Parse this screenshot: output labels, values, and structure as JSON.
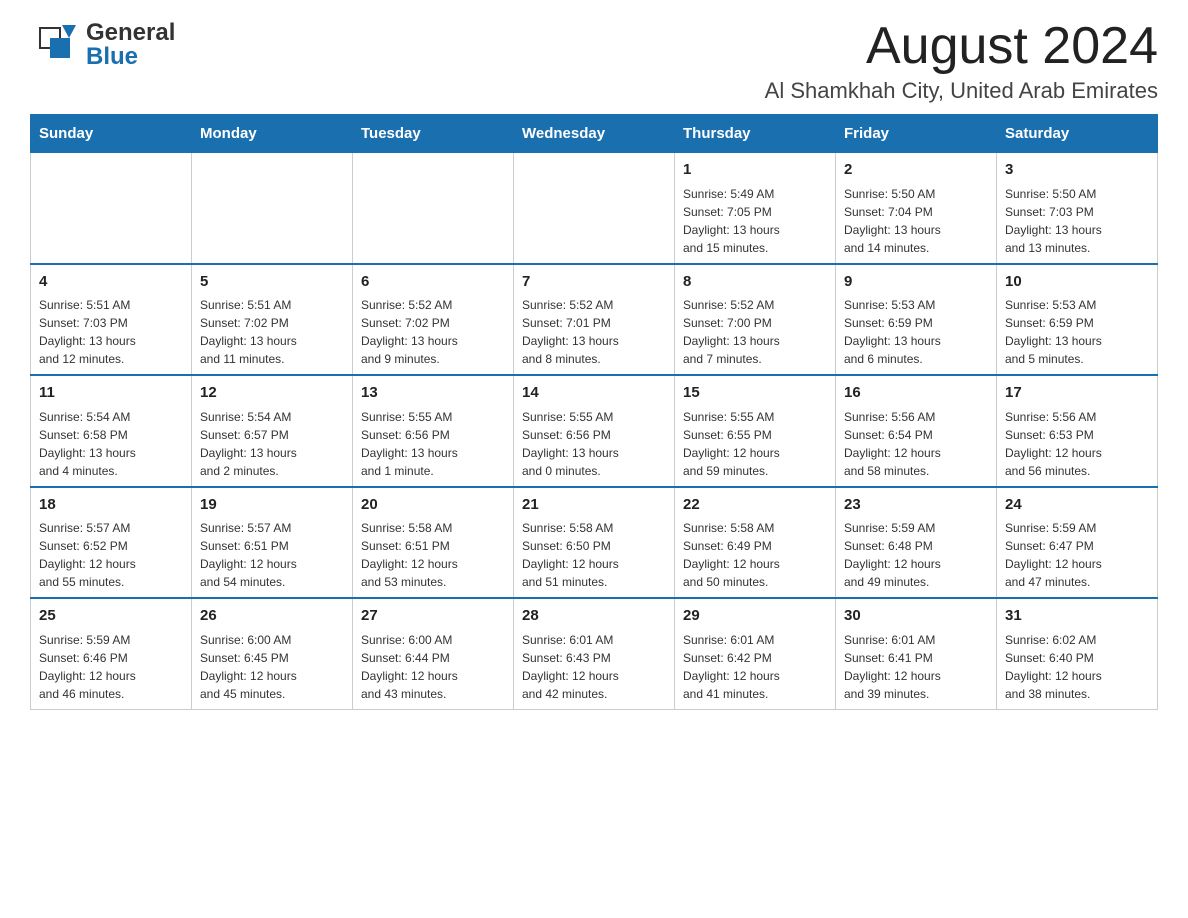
{
  "logo": {
    "general": "General",
    "blue": "Blue"
  },
  "title": "August 2024",
  "subtitle": "Al Shamkhah City, United Arab Emirates",
  "days_of_week": [
    "Sunday",
    "Monday",
    "Tuesday",
    "Wednesday",
    "Thursday",
    "Friday",
    "Saturday"
  ],
  "weeks": [
    [
      {
        "day": "",
        "info": ""
      },
      {
        "day": "",
        "info": ""
      },
      {
        "day": "",
        "info": ""
      },
      {
        "day": "",
        "info": ""
      },
      {
        "day": "1",
        "info": "Sunrise: 5:49 AM\nSunset: 7:05 PM\nDaylight: 13 hours\nand 15 minutes."
      },
      {
        "day": "2",
        "info": "Sunrise: 5:50 AM\nSunset: 7:04 PM\nDaylight: 13 hours\nand 14 minutes."
      },
      {
        "day": "3",
        "info": "Sunrise: 5:50 AM\nSunset: 7:03 PM\nDaylight: 13 hours\nand 13 minutes."
      }
    ],
    [
      {
        "day": "4",
        "info": "Sunrise: 5:51 AM\nSunset: 7:03 PM\nDaylight: 13 hours\nand 12 minutes."
      },
      {
        "day": "5",
        "info": "Sunrise: 5:51 AM\nSunset: 7:02 PM\nDaylight: 13 hours\nand 11 minutes."
      },
      {
        "day": "6",
        "info": "Sunrise: 5:52 AM\nSunset: 7:02 PM\nDaylight: 13 hours\nand 9 minutes."
      },
      {
        "day": "7",
        "info": "Sunrise: 5:52 AM\nSunset: 7:01 PM\nDaylight: 13 hours\nand 8 minutes."
      },
      {
        "day": "8",
        "info": "Sunrise: 5:52 AM\nSunset: 7:00 PM\nDaylight: 13 hours\nand 7 minutes."
      },
      {
        "day": "9",
        "info": "Sunrise: 5:53 AM\nSunset: 6:59 PM\nDaylight: 13 hours\nand 6 minutes."
      },
      {
        "day": "10",
        "info": "Sunrise: 5:53 AM\nSunset: 6:59 PM\nDaylight: 13 hours\nand 5 minutes."
      }
    ],
    [
      {
        "day": "11",
        "info": "Sunrise: 5:54 AM\nSunset: 6:58 PM\nDaylight: 13 hours\nand 4 minutes."
      },
      {
        "day": "12",
        "info": "Sunrise: 5:54 AM\nSunset: 6:57 PM\nDaylight: 13 hours\nand 2 minutes."
      },
      {
        "day": "13",
        "info": "Sunrise: 5:55 AM\nSunset: 6:56 PM\nDaylight: 13 hours\nand 1 minute."
      },
      {
        "day": "14",
        "info": "Sunrise: 5:55 AM\nSunset: 6:56 PM\nDaylight: 13 hours\nand 0 minutes."
      },
      {
        "day": "15",
        "info": "Sunrise: 5:55 AM\nSunset: 6:55 PM\nDaylight: 12 hours\nand 59 minutes."
      },
      {
        "day": "16",
        "info": "Sunrise: 5:56 AM\nSunset: 6:54 PM\nDaylight: 12 hours\nand 58 minutes."
      },
      {
        "day": "17",
        "info": "Sunrise: 5:56 AM\nSunset: 6:53 PM\nDaylight: 12 hours\nand 56 minutes."
      }
    ],
    [
      {
        "day": "18",
        "info": "Sunrise: 5:57 AM\nSunset: 6:52 PM\nDaylight: 12 hours\nand 55 minutes."
      },
      {
        "day": "19",
        "info": "Sunrise: 5:57 AM\nSunset: 6:51 PM\nDaylight: 12 hours\nand 54 minutes."
      },
      {
        "day": "20",
        "info": "Sunrise: 5:58 AM\nSunset: 6:51 PM\nDaylight: 12 hours\nand 53 minutes."
      },
      {
        "day": "21",
        "info": "Sunrise: 5:58 AM\nSunset: 6:50 PM\nDaylight: 12 hours\nand 51 minutes."
      },
      {
        "day": "22",
        "info": "Sunrise: 5:58 AM\nSunset: 6:49 PM\nDaylight: 12 hours\nand 50 minutes."
      },
      {
        "day": "23",
        "info": "Sunrise: 5:59 AM\nSunset: 6:48 PM\nDaylight: 12 hours\nand 49 minutes."
      },
      {
        "day": "24",
        "info": "Sunrise: 5:59 AM\nSunset: 6:47 PM\nDaylight: 12 hours\nand 47 minutes."
      }
    ],
    [
      {
        "day": "25",
        "info": "Sunrise: 5:59 AM\nSunset: 6:46 PM\nDaylight: 12 hours\nand 46 minutes."
      },
      {
        "day": "26",
        "info": "Sunrise: 6:00 AM\nSunset: 6:45 PM\nDaylight: 12 hours\nand 45 minutes."
      },
      {
        "day": "27",
        "info": "Sunrise: 6:00 AM\nSunset: 6:44 PM\nDaylight: 12 hours\nand 43 minutes."
      },
      {
        "day": "28",
        "info": "Sunrise: 6:01 AM\nSunset: 6:43 PM\nDaylight: 12 hours\nand 42 minutes."
      },
      {
        "day": "29",
        "info": "Sunrise: 6:01 AM\nSunset: 6:42 PM\nDaylight: 12 hours\nand 41 minutes."
      },
      {
        "day": "30",
        "info": "Sunrise: 6:01 AM\nSunset: 6:41 PM\nDaylight: 12 hours\nand 39 minutes."
      },
      {
        "day": "31",
        "info": "Sunrise: 6:02 AM\nSunset: 6:40 PM\nDaylight: 12 hours\nand 38 minutes."
      }
    ]
  ]
}
